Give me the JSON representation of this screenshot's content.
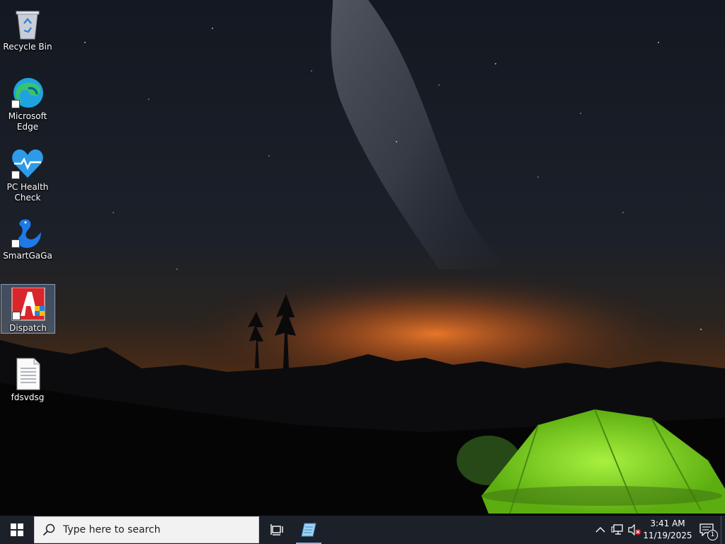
{
  "desktop": {
    "icons": [
      {
        "label": "Recycle Bin",
        "icon": "recycle-bin-icon"
      },
      {
        "label": "Microsoft Edge",
        "icon": "edge-icon"
      },
      {
        "label": "PC Health Check",
        "icon": "pc-health-check-icon"
      },
      {
        "label": "SmartGaGa",
        "icon": "smartgaga-icon"
      },
      {
        "label": "Dispatch",
        "icon": "dispatch-icon",
        "selected": true
      },
      {
        "label": "fdsvdsg",
        "icon": "text-file-icon"
      }
    ]
  },
  "taskbar": {
    "start_icon": "windows-logo-icon",
    "search_placeholder": "Type here to search",
    "task_view_icon": "task-view-icon",
    "pinned_app_icon": "notepad-icon",
    "tray": {
      "chevron_icon": "chevron-up-icon",
      "network_icon": "network-icon",
      "volume_icon": "volume-muted-icon",
      "time": "3:41 AM",
      "date": "11/19/2025",
      "notification_icon": "action-center-icon",
      "notification_count": "1"
    }
  },
  "colors": {
    "taskbar_bg": "#1c2029",
    "accent": "#76b9ed",
    "tent_green": "#7ed321",
    "horizon_orange": "#e8601a"
  }
}
